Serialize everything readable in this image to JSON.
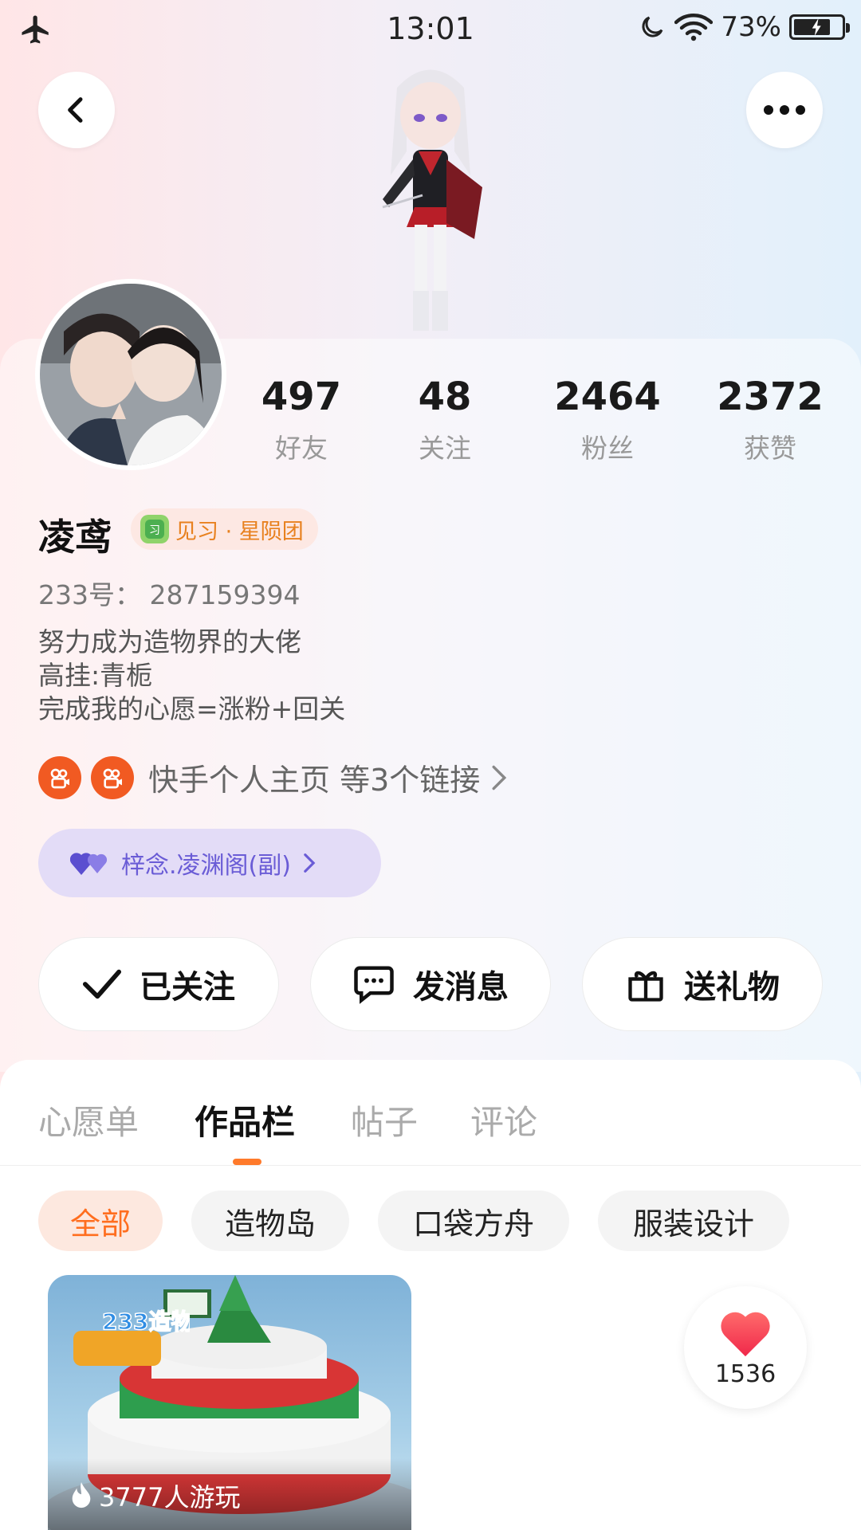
{
  "status_bar": {
    "time": "13:01",
    "battery": "73%"
  },
  "profile": {
    "stats": [
      {
        "value": "497",
        "label": "好友"
      },
      {
        "value": "48",
        "label": "关注"
      },
      {
        "value": "2464",
        "label": "粉丝"
      },
      {
        "value": "2372",
        "label": "获赞"
      }
    ],
    "name": "凌鸢",
    "title_badge": "见习 · 星陨团",
    "uid": "233号：  287159394",
    "bio": [
      "努力成为造物界的大佬",
      "高挂:青栀",
      "完成我的心愿=涨粉+回关"
    ],
    "links_text": "快手个人主页 等3个链接",
    "guild": "梓念.凌渊阁(副)"
  },
  "actions": {
    "follow": "已关注",
    "message": "发消息",
    "gift": "送礼物"
  },
  "tabs": [
    "心愿单",
    "作品栏",
    "帖子",
    "评论"
  ],
  "filter_chips": [
    "全部",
    "造物岛",
    "口袋方舟",
    "服装设计"
  ],
  "works": [
    {
      "plays": "3777人游玩",
      "logo_text": "233造物岛"
    }
  ],
  "like_count": "1536"
}
